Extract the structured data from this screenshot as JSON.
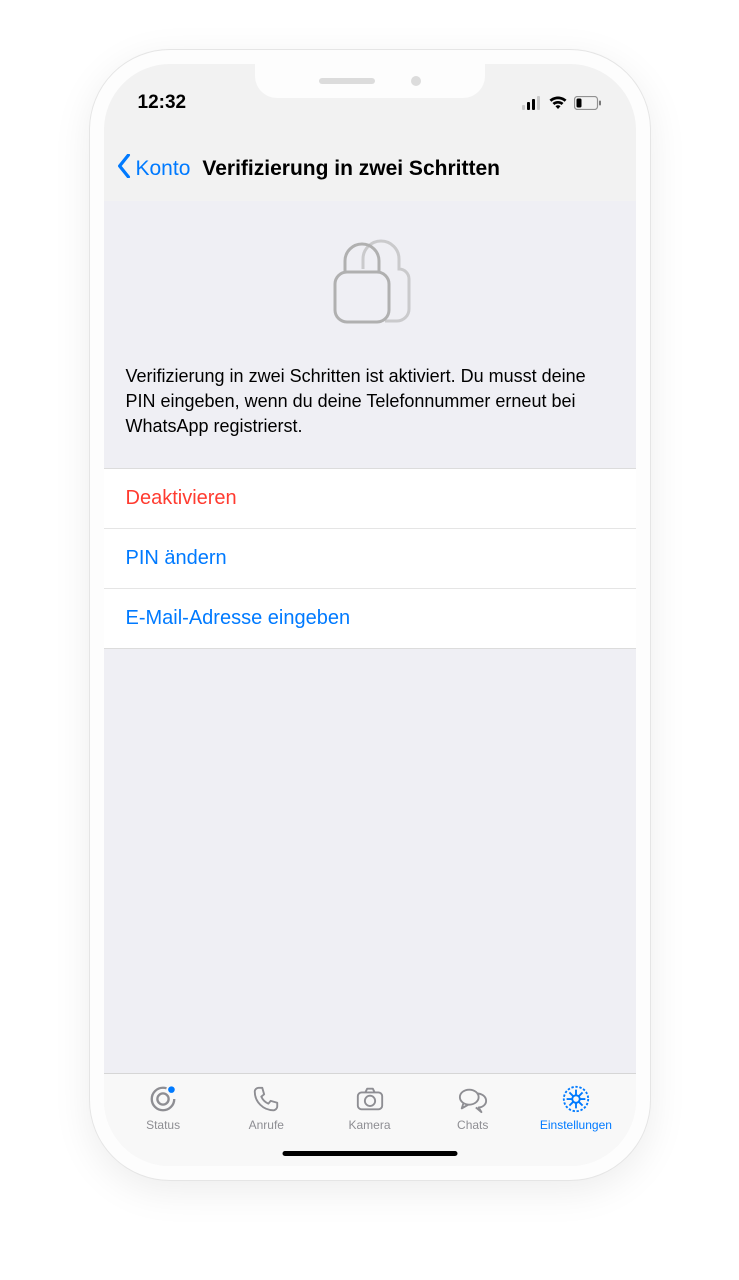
{
  "statusBar": {
    "time": "12:32"
  },
  "nav": {
    "back": "Konto",
    "title": "Verifizierung in zwei Schritten"
  },
  "hero": {
    "info": "Verifizierung in zwei Schritten ist aktiviert. Du musst deine PIN eingeben, wenn du deine Telefonnummer erneut bei WhatsApp registrierst."
  },
  "actions": {
    "disable": "Deaktivieren",
    "changePin": "PIN ändern",
    "enterEmail": "E-Mail-Adresse eingeben"
  },
  "tabs": {
    "status": "Status",
    "calls": "Anrufe",
    "camera": "Kamera",
    "chats": "Chats",
    "settings": "Einstellungen"
  }
}
